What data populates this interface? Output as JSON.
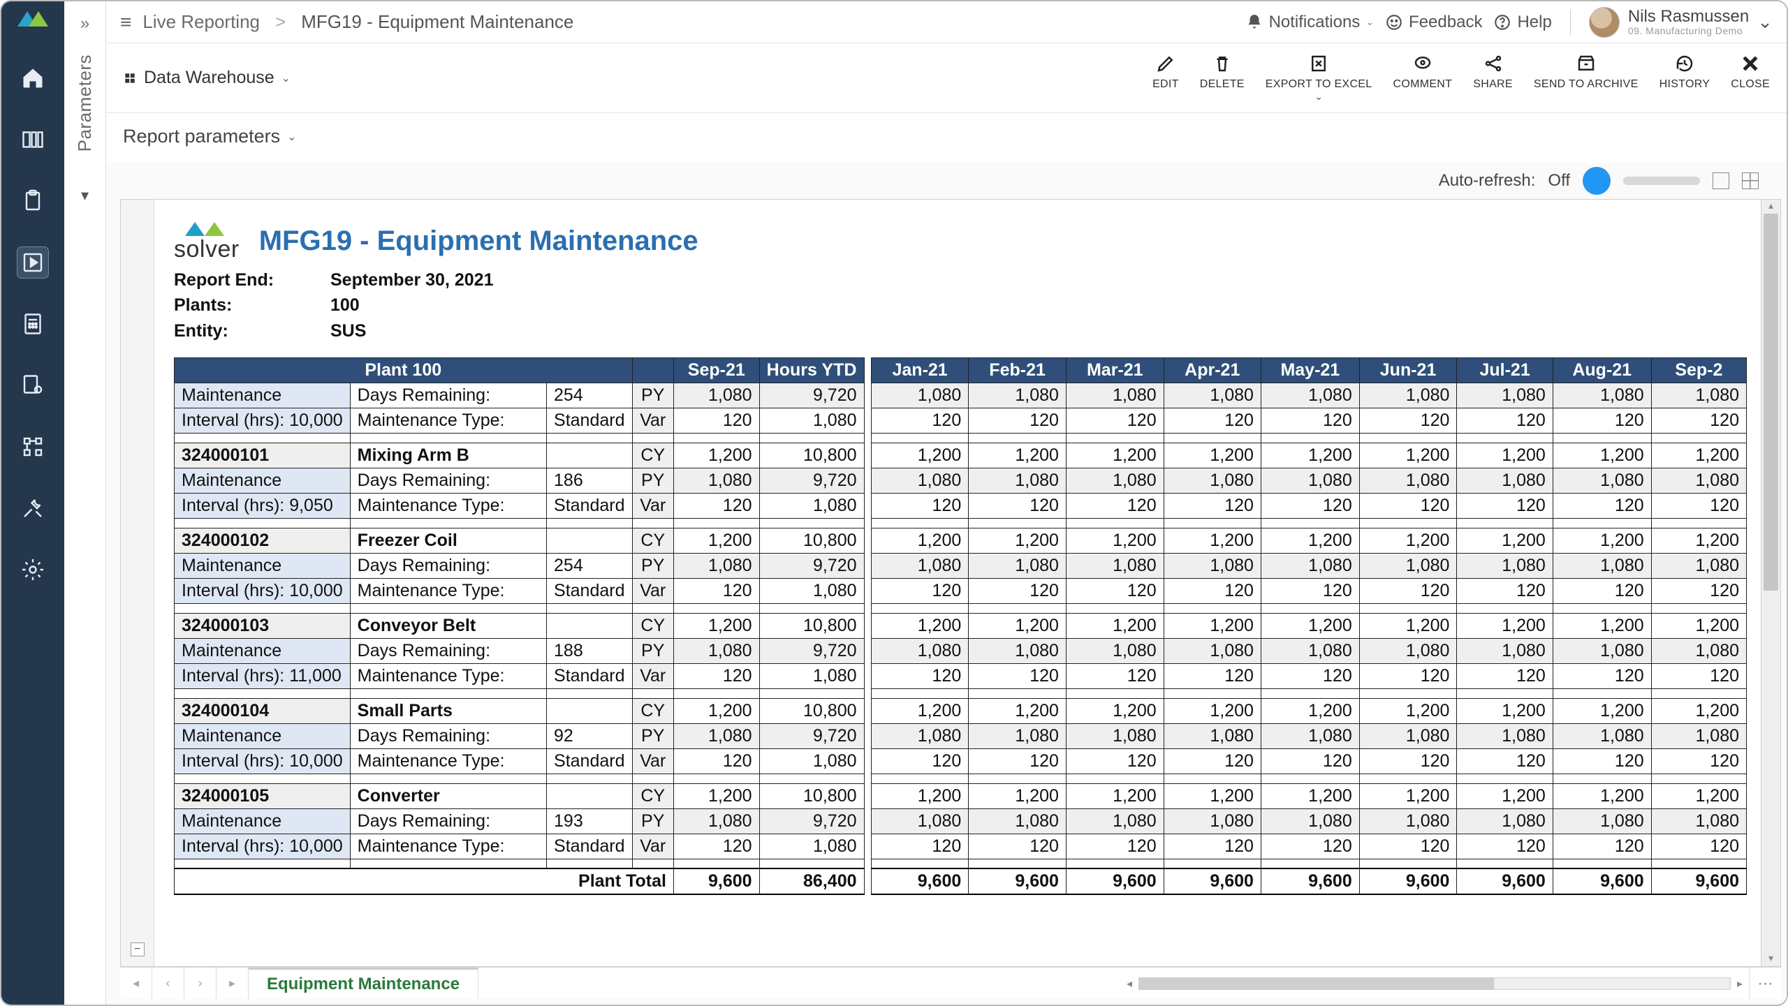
{
  "breadcrumb": {
    "root": "Live Reporting",
    "separator": ">",
    "leaf": "MFG19 - Equipment Maintenance"
  },
  "topbar": {
    "notifications": "Notifications",
    "feedback": "Feedback",
    "help": "Help",
    "user_name": "Nils Rasmussen",
    "user_sub": "09. Manufacturing Demo"
  },
  "toolbar": {
    "data_warehouse": "Data Warehouse",
    "actions": {
      "edit": "EDIT",
      "delete": "DELETE",
      "export": "EXPORT TO EXCEL",
      "comment": "COMMENT",
      "share": "SHARE",
      "archive": "SEND TO ARCHIVE",
      "history": "HISTORY",
      "close": "CLOSE"
    }
  },
  "parameters_label": "Parameters",
  "report_parameters": "Report parameters",
  "viewer": {
    "auto_refresh_label": "Auto-refresh:",
    "auto_refresh_state": "Off"
  },
  "report": {
    "brand": "solver",
    "title": "MFG19 - Equipment Maintenance",
    "meta": {
      "report_end_k": "Report End:",
      "report_end_v": "September 30, 2021",
      "plants_k": "Plants:",
      "plants_v": "100",
      "entity_k": "Entity:",
      "entity_v": "SUS"
    },
    "headers": {
      "plant": "Plant 100",
      "sep21": "Sep-21",
      "hoursytd": "Hours YTD",
      "months": [
        "Jan-21",
        "Feb-21",
        "Mar-21",
        "Apr-21",
        "May-21",
        "Jun-21",
        "Jul-21",
        "Aug-21",
        "Sep-2"
      ]
    },
    "labels": {
      "maintenance": "Maintenance",
      "days_remaining": "Days Remaining:",
      "interval": "Interval (hrs):",
      "maint_type": "Maintenance Type:",
      "standard": "Standard",
      "cy": "CY",
      "py": "PY",
      "var": "Var",
      "plant_total": "Plant Total"
    },
    "groups": [
      {
        "id": "",
        "name": "",
        "days": "254",
        "interval": "10,000",
        "cy": null,
        "py": {
          "sep": "1,080",
          "ytd": "9,720",
          "m": [
            "1,080",
            "1,080",
            "1,080",
            "1,080",
            "1,080",
            "1,080",
            "1,080",
            "1,080",
            "1,080"
          ]
        },
        "var": {
          "sep": "120",
          "ytd": "1,080",
          "m": [
            "120",
            "120",
            "120",
            "120",
            "120",
            "120",
            "120",
            "120",
            "120"
          ]
        }
      },
      {
        "id": "324000101",
        "name": "Mixing Arm B",
        "days": "186",
        "interval": "9,050",
        "cy": {
          "sep": "1,200",
          "ytd": "10,800",
          "m": [
            "1,200",
            "1,200",
            "1,200",
            "1,200",
            "1,200",
            "1,200",
            "1,200",
            "1,200",
            "1,200"
          ]
        },
        "py": {
          "sep": "1,080",
          "ytd": "9,720",
          "m": [
            "1,080",
            "1,080",
            "1,080",
            "1,080",
            "1,080",
            "1,080",
            "1,080",
            "1,080",
            "1,080"
          ]
        },
        "var": {
          "sep": "120",
          "ytd": "1,080",
          "m": [
            "120",
            "120",
            "120",
            "120",
            "120",
            "120",
            "120",
            "120",
            "120"
          ]
        }
      },
      {
        "id": "324000102",
        "name": "Freezer Coil",
        "days": "254",
        "interval": "10,000",
        "cy": {
          "sep": "1,200",
          "ytd": "10,800",
          "m": [
            "1,200",
            "1,200",
            "1,200",
            "1,200",
            "1,200",
            "1,200",
            "1,200",
            "1,200",
            "1,200"
          ]
        },
        "py": {
          "sep": "1,080",
          "ytd": "9,720",
          "m": [
            "1,080",
            "1,080",
            "1,080",
            "1,080",
            "1,080",
            "1,080",
            "1,080",
            "1,080",
            "1,080"
          ]
        },
        "var": {
          "sep": "120",
          "ytd": "1,080",
          "m": [
            "120",
            "120",
            "120",
            "120",
            "120",
            "120",
            "120",
            "120",
            "120"
          ]
        }
      },
      {
        "id": "324000103",
        "name": "Conveyor Belt",
        "days": "188",
        "interval": "11,000",
        "cy": {
          "sep": "1,200",
          "ytd": "10,800",
          "m": [
            "1,200",
            "1,200",
            "1,200",
            "1,200",
            "1,200",
            "1,200",
            "1,200",
            "1,200",
            "1,200"
          ]
        },
        "py": {
          "sep": "1,080",
          "ytd": "9,720",
          "m": [
            "1,080",
            "1,080",
            "1,080",
            "1,080",
            "1,080",
            "1,080",
            "1,080",
            "1,080",
            "1,080"
          ]
        },
        "var": {
          "sep": "120",
          "ytd": "1,080",
          "m": [
            "120",
            "120",
            "120",
            "120",
            "120",
            "120",
            "120",
            "120",
            "120"
          ]
        }
      },
      {
        "id": "324000104",
        "name": "Small Parts",
        "days": "92",
        "interval": "10,000",
        "cy": {
          "sep": "1,200",
          "ytd": "10,800",
          "m": [
            "1,200",
            "1,200",
            "1,200",
            "1,200",
            "1,200",
            "1,200",
            "1,200",
            "1,200",
            "1,200"
          ]
        },
        "py": {
          "sep": "1,080",
          "ytd": "9,720",
          "m": [
            "1,080",
            "1,080",
            "1,080",
            "1,080",
            "1,080",
            "1,080",
            "1,080",
            "1,080",
            "1,080"
          ]
        },
        "var": {
          "sep": "120",
          "ytd": "1,080",
          "m": [
            "120",
            "120",
            "120",
            "120",
            "120",
            "120",
            "120",
            "120",
            "120"
          ]
        }
      },
      {
        "id": "324000105",
        "name": "Converter",
        "days": "193",
        "interval": "10,000",
        "cy": {
          "sep": "1,200",
          "ytd": "10,800",
          "m": [
            "1,200",
            "1,200",
            "1,200",
            "1,200",
            "1,200",
            "1,200",
            "1,200",
            "1,200",
            "1,200"
          ]
        },
        "py": {
          "sep": "1,080",
          "ytd": "9,720",
          "m": [
            "1,080",
            "1,080",
            "1,080",
            "1,080",
            "1,080",
            "1,080",
            "1,080",
            "1,080",
            "1,080"
          ]
        },
        "var": {
          "sep": "120",
          "ytd": "1,080",
          "m": [
            "120",
            "120",
            "120",
            "120",
            "120",
            "120",
            "120",
            "120",
            "120"
          ]
        }
      }
    ],
    "totals": {
      "sep": "9,600",
      "ytd": "86,400",
      "m": [
        "9,600",
        "9,600",
        "9,600",
        "9,600",
        "9,600",
        "9,600",
        "9,600",
        "9,600",
        "9,600"
      ]
    }
  },
  "tab": "Equipment Maintenance"
}
